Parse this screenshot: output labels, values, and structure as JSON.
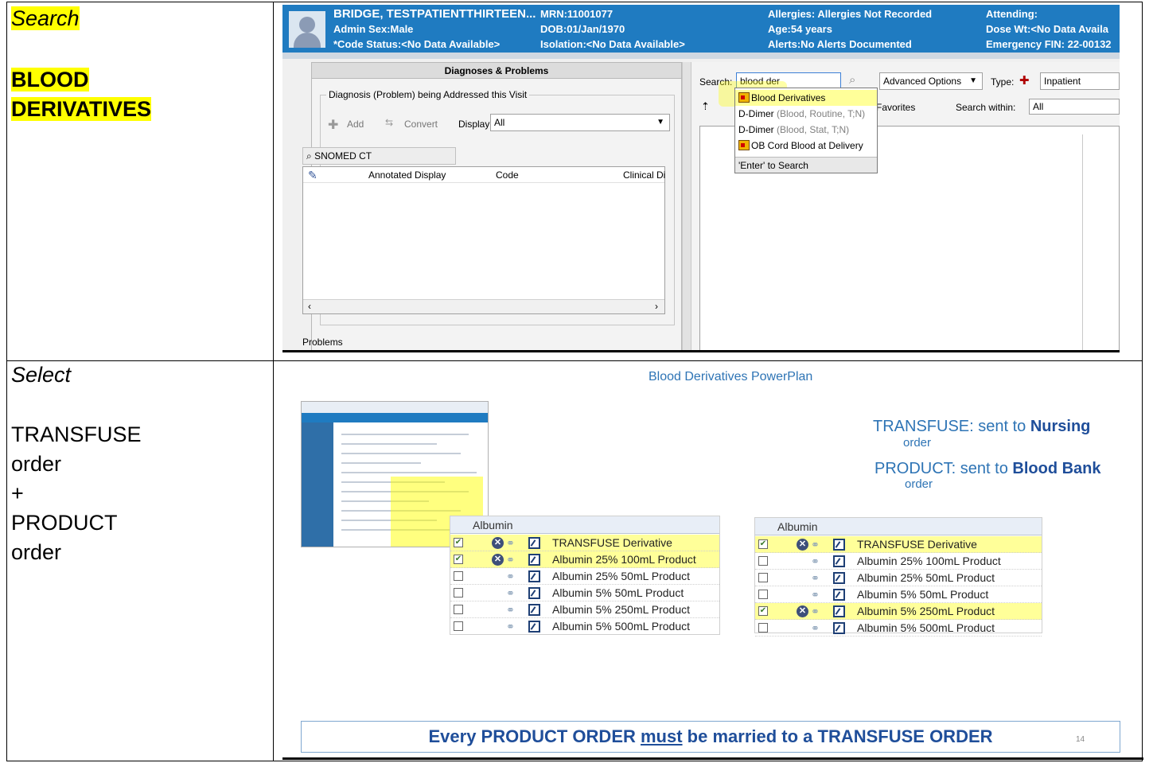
{
  "steps": [
    {
      "label": "Search",
      "target_lines": [
        "BLOOD",
        "DERIVATIVES"
      ]
    },
    {
      "label": "Select",
      "lines": [
        "TRANSFUSE",
        "order",
        "+",
        "PRODUCT",
        "order"
      ]
    }
  ],
  "patient_banner": {
    "name": "BRIDGE, TESTPATIENTTHIRTEEN...",
    "admin_sex": "Admin Sex:Male",
    "code_status": "*Code Status:<No Data Available>",
    "mrn": "MRN:11001077",
    "dob": "DOB:01/Jan/1970",
    "isolation": "Isolation:<No Data Available>",
    "allergies": "Allergies: Allergies Not Recorded",
    "age": "Age:54 years",
    "alerts": "Alerts:No Alerts Documented",
    "attending": "Attending:",
    "dose_wt": "Dose Wt:<No Data Availa",
    "emergency_fin": "Emergency FIN: 22-00132"
  },
  "diagnoses_panel": {
    "title": "Diagnoses & Problems",
    "group_title": "Diagnosis (Problem) being Addressed this Visit",
    "add_label": "Add",
    "convert_label": "Convert",
    "display_label": "Display:",
    "display_value": "All",
    "snomed_label": "SNOMED CT",
    "columns": [
      "Annotated Display",
      "Code",
      "Clinical Di"
    ],
    "problems_label": "Problems"
  },
  "search_pane": {
    "search_label": "Search:",
    "search_value": "blood der",
    "advanced_label": "Advanced Options",
    "type_label": "Type:",
    "type_value": "Inpatient",
    "folder_label": "er:Favorites",
    "within_label": "Search within:",
    "within_value": "All",
    "dropdown": [
      {
        "main": "Blood Derivatives",
        "grey": "",
        "icon": true,
        "selected": true
      },
      {
        "main": "D-Dimer ",
        "grey": "(Blood, Routine, T;N)",
        "icon": false,
        "selected": false
      },
      {
        "main": "D-Dimer ",
        "grey": "(Blood, Stat, T;N)",
        "icon": false,
        "selected": false
      },
      {
        "main": "OB Cord Blood at Delivery",
        "grey": "",
        "icon": true,
        "selected": false
      }
    ],
    "dropdown_footer": "'Enter' to Search"
  },
  "slide": {
    "title": "Blood Derivatives PowerPlan",
    "transfuse_note": {
      "prefix": "TRANSFUSE: sent to ",
      "bold": "Nursing",
      "sub": "order"
    },
    "product_note": {
      "prefix": "PRODUCT: sent to ",
      "bold": "Blood Bank",
      "sub": "order"
    },
    "albumin_header": "Albumin",
    "albumin_items": [
      "TRANSFUSE Derivative",
      "Albumin 25% 100mL Product",
      "Albumin 25% 50mL Product",
      "Albumin 5% 50mL Product",
      "Albumin 5% 250mL Product",
      "Albumin 5% 500mL Product"
    ],
    "left_selected": [
      true,
      true,
      false,
      false,
      false,
      false
    ],
    "right_selected": [
      true,
      false,
      false,
      false,
      true,
      false
    ],
    "married_prefix": "Every PRODUCT ORDER ",
    "married_emph": "must",
    "married_suffix": " be married to a TRANSFUSE ORDER",
    "page_number": "14"
  }
}
